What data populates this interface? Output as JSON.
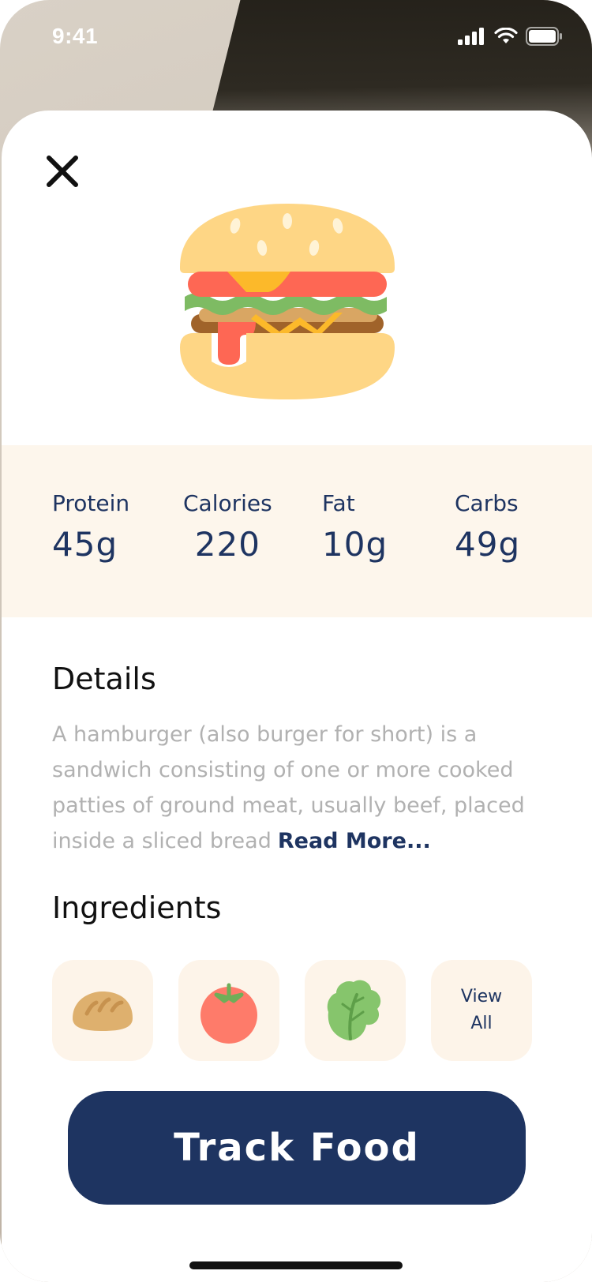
{
  "status_bar": {
    "time": "9:41"
  },
  "macros": [
    {
      "label": "Protein",
      "value": "45g"
    },
    {
      "label": "Calories",
      "value": "220"
    },
    {
      "label": "Fat",
      "value": "10g"
    },
    {
      "label": "Carbs",
      "value": "49g"
    }
  ],
  "details": {
    "title": "Details",
    "text": "A hamburger (also burger for short) is a sandwich consisting of one or more cooked patties of ground meat, usually beef, placed inside a sliced bread",
    "read_more": "Read More..."
  },
  "ingredients": {
    "title": "Ingredients",
    "items": [
      "bread-icon",
      "tomato-icon",
      "lettuce-icon"
    ],
    "view_all_line1": "View",
    "view_all_line2": "All"
  },
  "track_button": {
    "label": "Track Food"
  },
  "colors": {
    "accent": "#1e3461",
    "macro_bg": "#fdf6ec",
    "tile_bg": "#fdf4e9"
  }
}
